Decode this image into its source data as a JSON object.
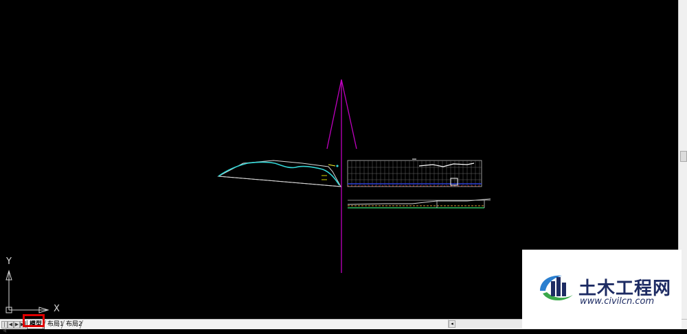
{
  "app": {
    "name": "AutoCAD model space"
  },
  "ucs": {
    "y_label": "Y",
    "x_label": "X"
  },
  "tabs": {
    "model": "模型",
    "layout1": "布局1",
    "layout2": "布局2",
    "active": "model"
  },
  "watermark": {
    "name": "土木工程网",
    "url": "www.civilcn.com"
  },
  "colors": {
    "background": "#000000",
    "axis_line": "#c000c0",
    "profile_curve": "#33d6d6",
    "highlight": "#e00000",
    "watermark_text": "#1d2b63"
  }
}
